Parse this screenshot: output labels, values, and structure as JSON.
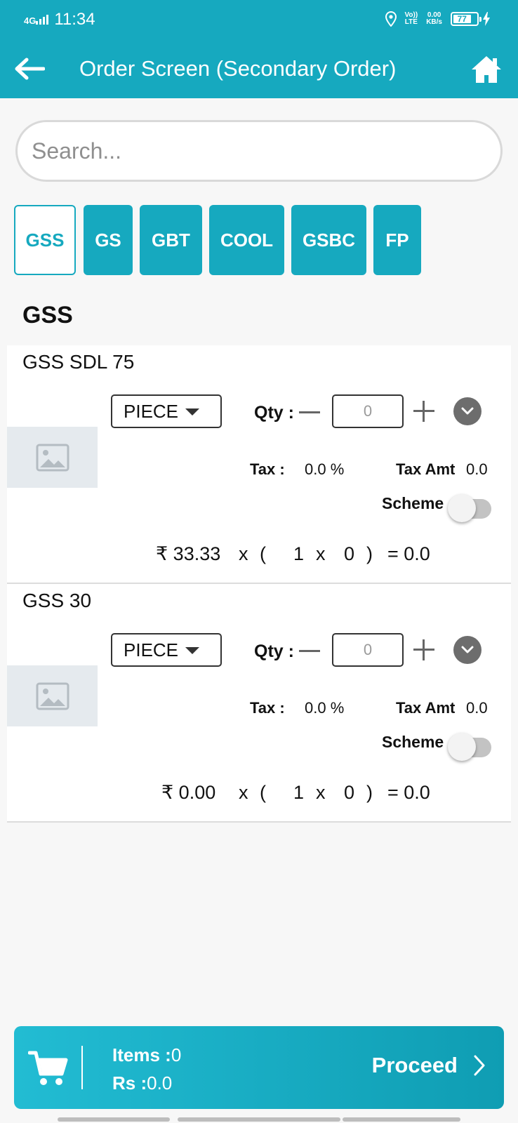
{
  "status_bar": {
    "network": "4G",
    "time": "11:34",
    "volte_top": "Vo))",
    "volte_bottom": "LTE",
    "speed_value": "0.00",
    "speed_unit": "KB/s",
    "battery": "77",
    "battery_level": 0.77,
    "icons": [
      "signal-icon",
      "location-icon",
      "volte-icon",
      "battery-icon",
      "charging-icon"
    ]
  },
  "app_bar": {
    "title": "Order Screen (Secondary Order)",
    "back_icon": "back-arrow-icon",
    "home_icon": "home-icon",
    "color": "#16a9bf"
  },
  "search": {
    "placeholder": "Search..."
  },
  "tabs": [
    {
      "label": "GSS",
      "active": true
    },
    {
      "label": "GS"
    },
    {
      "label": "GBT"
    },
    {
      "label": "COOL"
    },
    {
      "label": "GSBC"
    },
    {
      "label": "FP"
    }
  ],
  "section_title": "GSS",
  "products": [
    {
      "name": "GSS SDL 75",
      "unit": "PIECE",
      "qty_label": "Qty :",
      "qty_value": "0",
      "tax_label": "Tax :",
      "tax_value": "0.0 %",
      "tax_amt_label": "Tax Amt",
      "tax_amt_value": "0.0",
      "scheme_label": "Scheme",
      "scheme_on": false,
      "price": "₹ 33.33",
      "calc_x": "x",
      "calc_open": "(",
      "calc_pack": "1",
      "calc_x2": "x",
      "calc_qty": "0",
      "calc_close": ")",
      "calc_total": "= 0.0"
    },
    {
      "name": "GSS 30",
      "unit": "PIECE",
      "qty_label": "Qty :",
      "qty_value": "0",
      "tax_label": "Tax :",
      "tax_value": "0.0 %",
      "tax_amt_label": "Tax Amt",
      "tax_amt_value": "0.0",
      "scheme_label": "Scheme",
      "scheme_on": false,
      "price": "₹ 0.00",
      "calc_x": "x",
      "calc_open": "(",
      "calc_pack": "1",
      "calc_x2": "x",
      "calc_qty": "0",
      "calc_close": ")",
      "calc_total": "= 0.0"
    }
  ],
  "footer": {
    "items_label": "Items :",
    "items_value": "0",
    "rs_label": "Rs :",
    "rs_value": "0.0",
    "proceed_label": "Proceed",
    "cart_icon": "cart-icon",
    "chevron_icon": "chevron-right-icon"
  }
}
